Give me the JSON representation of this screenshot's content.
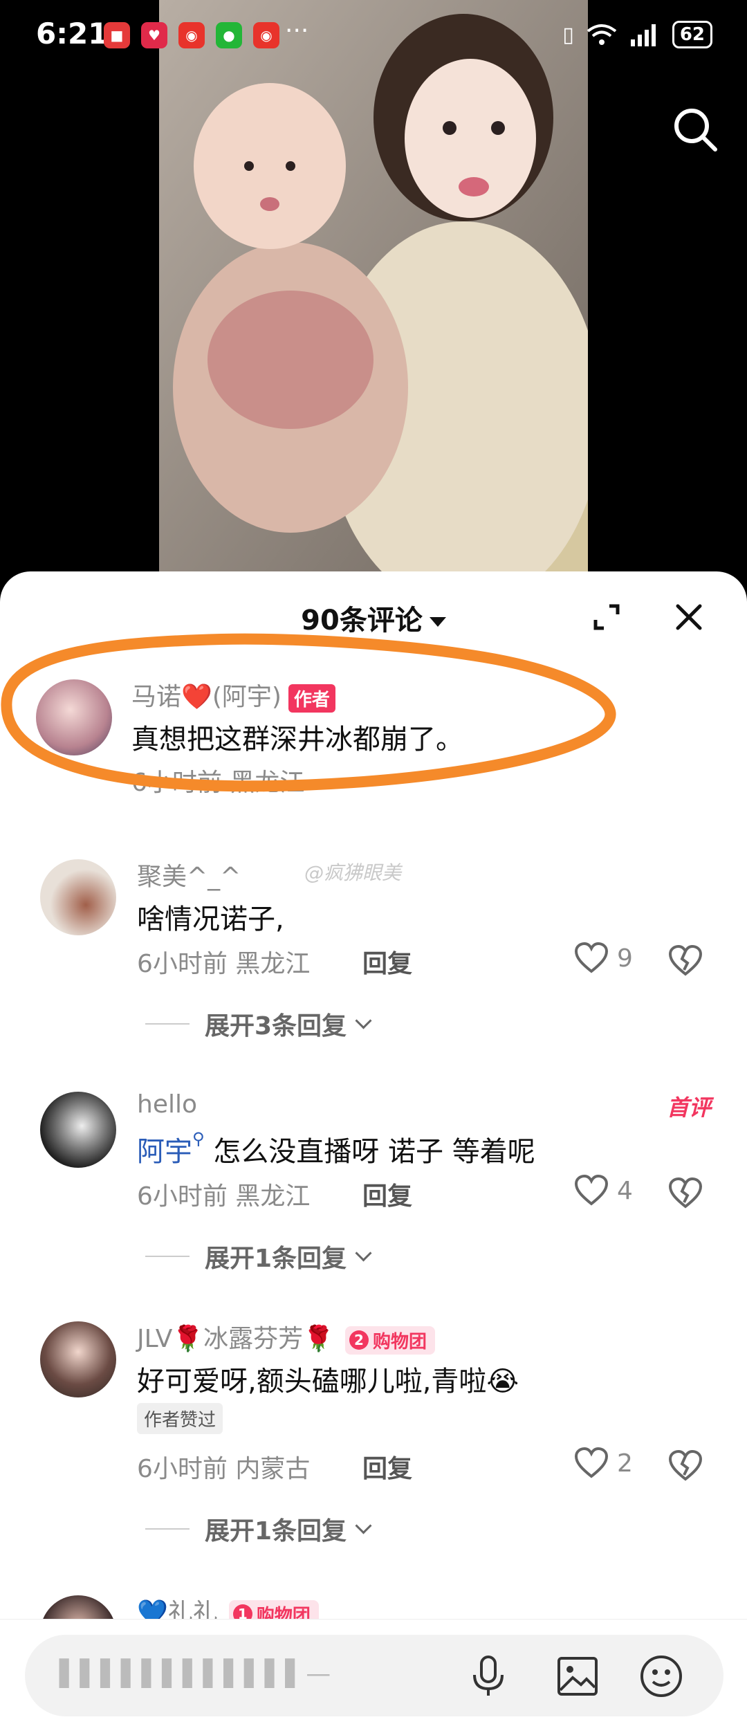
{
  "status_bar": {
    "time": "6:21",
    "battery": "62",
    "more": "···"
  },
  "sheet": {
    "comment_count": "90条评论"
  },
  "comments": [
    {
      "username": "马诺❤️(阿宇)",
      "badge": "作者",
      "text": "真想把这群深井冰都崩了。",
      "meta": "6小时前 黑龙江"
    },
    {
      "username": "聚美^_^",
      "text": "啥情况诺子,",
      "meta": "6小时前 黑龙江",
      "reply": "回复",
      "likes": "9",
      "expand": "展开3条回复"
    },
    {
      "username": "hello",
      "first_badge": "首评",
      "mention": "阿宇",
      "text": "怎么没直播呀 诺子 等着呢",
      "meta": "6小时前 黑龙江",
      "reply": "回复",
      "likes": "4",
      "expand": "展开1条回复"
    },
    {
      "username": "JLV🌹冰露芬芳🌹",
      "group_badge": "购物团",
      "group_level": "2",
      "text": "好可爱呀,额头磕哪儿啦,青啦😭",
      "liked_tag": "作者赞过",
      "meta": "6小时前 内蒙古",
      "reply": "回复",
      "likes": "2",
      "expand": "展开1条回复"
    },
    {
      "username": "💙礼礼",
      "group_badge": "购物团",
      "group_level": "1"
    }
  ],
  "watermark": "@疯狒眼美",
  "input": {
    "placeholder": "▌▌▌▌▌▌▌▌▌▌▌▌—"
  },
  "colors": {
    "accent": "#f2365f",
    "highlight_circle": "#f58a2a",
    "mention": "#2a5cb8"
  }
}
